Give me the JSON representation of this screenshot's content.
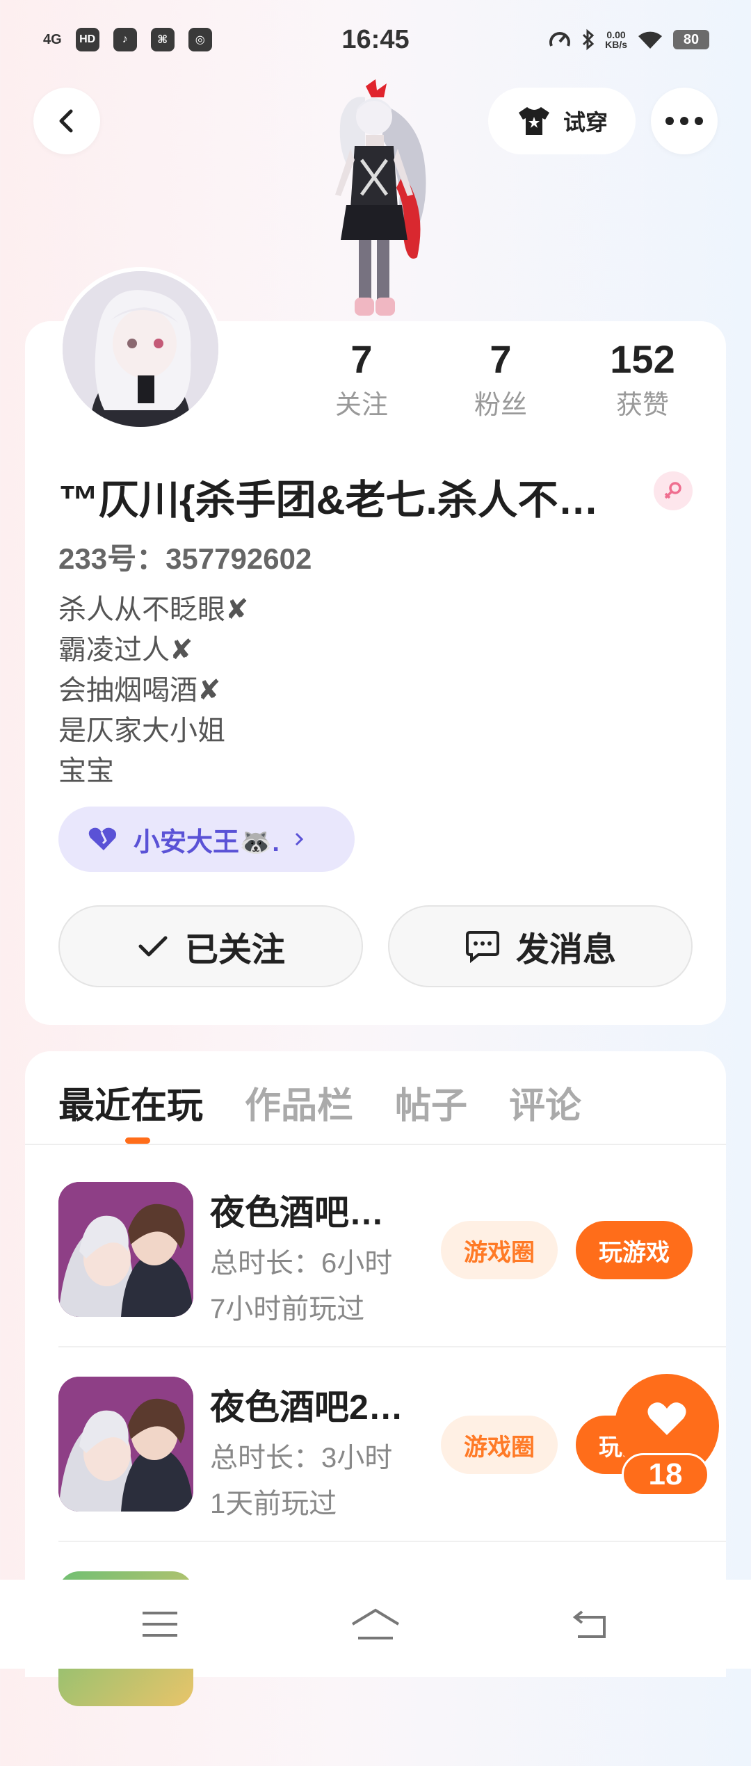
{
  "status_bar": {
    "time": "16:45",
    "signal": "4G",
    "hd": "HD",
    "net_speed_value": "0.00",
    "net_speed_unit": "KB/s",
    "battery": "80"
  },
  "header": {
    "try_on_label": "试穿"
  },
  "profile": {
    "stats": [
      {
        "value": "7",
        "label": "关注"
      },
      {
        "value": "7",
        "label": "粉丝"
      },
      {
        "value": "152",
        "label": "获赞"
      }
    ],
    "username": "™仄川{杀手团&老七.杀人不…",
    "uid": "233号：357792602",
    "bio": [
      "杀人从不眨眼✘",
      "霸凌过人✘",
      "会抽烟喝酒✘",
      "是仄家大小姐",
      "宝宝"
    ],
    "relation_name": "小安大王🦝.",
    "follow_label": "已关注",
    "message_label": "发消息"
  },
  "tabs": [
    {
      "label": "最近在玩",
      "active": true
    },
    {
      "label": "作品栏",
      "active": false
    },
    {
      "label": "帖子",
      "active": false
    },
    {
      "label": "评论",
      "active": false
    }
  ],
  "games": [
    {
      "title": "夜色酒吧…",
      "duration": "总时长：6小时",
      "last_played": "7小时前玩过",
      "circle_label": "游戏圈",
      "play_label": "玩游戏"
    },
    {
      "title": "夜色酒吧2…",
      "duration": "总时长：3小时",
      "last_played": "1天前玩过",
      "circle_label": "游戏圈",
      "play_label": "玩游戏"
    }
  ],
  "like_fab": {
    "count": "18"
  },
  "colors": {
    "accent": "#ff6d1a",
    "relation_bg": "#e9e7fc",
    "relation_text": "#5a52d6"
  }
}
